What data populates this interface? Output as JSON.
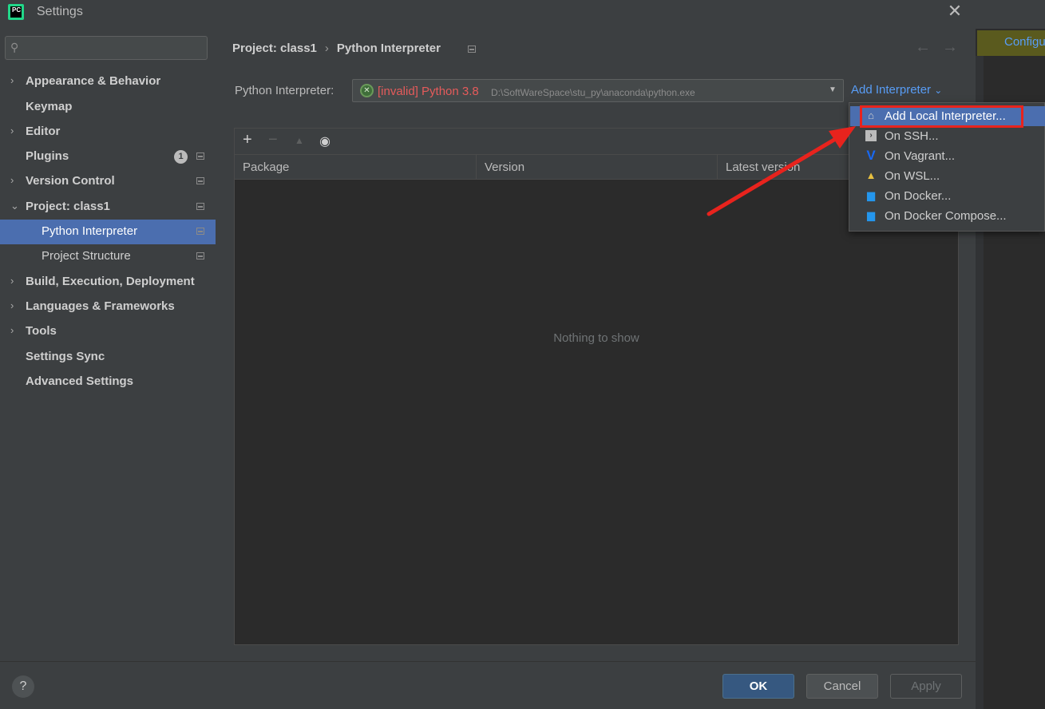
{
  "window": {
    "title": "Settings",
    "logo_text": "PC",
    "close_glyph": "✕"
  },
  "background_editor": {
    "banner_text": "Configure"
  },
  "search": {
    "placeholder": "",
    "icon": "search-icon"
  },
  "sidebar": {
    "items": [
      {
        "label": "Appearance & Behavior",
        "expandable": true,
        "expanded": false
      },
      {
        "label": "Keymap",
        "expandable": false
      },
      {
        "label": "Editor",
        "expandable": true,
        "expanded": false
      },
      {
        "label": "Plugins",
        "expandable": false,
        "badge": "1"
      },
      {
        "label": "Version Control",
        "expandable": true,
        "expanded": false
      },
      {
        "label": "Project: class1",
        "expandable": true,
        "expanded": true
      },
      {
        "label": "Python Interpreter",
        "sub": true,
        "selected": true
      },
      {
        "label": "Project Structure",
        "sub": true
      },
      {
        "label": "Build, Execution, Deployment",
        "expandable": true,
        "expanded": false
      },
      {
        "label": "Languages & Frameworks",
        "expandable": true,
        "expanded": false
      },
      {
        "label": "Tools",
        "expandable": true,
        "expanded": false
      },
      {
        "label": "Settings Sync",
        "expandable": false
      },
      {
        "label": "Advanced Settings",
        "expandable": false
      }
    ]
  },
  "breadcrumb": {
    "parent": "Project: class1",
    "separator": "›",
    "current": "Python Interpreter"
  },
  "nav": {
    "back": "←",
    "forward": "→"
  },
  "interpreter": {
    "label": "Python Interpreter:",
    "status": "[invalid] Python 3.8",
    "path": "D:\\SoftWareSpace\\stu_py\\anaconda\\python.exe",
    "add_label": "Add Interpreter",
    "add_chevron": "⌄"
  },
  "packages": {
    "toolbar": {
      "add": "+",
      "remove": "−",
      "up": "▲",
      "show": "👁"
    },
    "columns": [
      "Package",
      "Version",
      "Latest version"
    ],
    "empty_text": "Nothing to show"
  },
  "menu": {
    "items": [
      {
        "label": "Add Local Interpreter...",
        "icon": "home-icon",
        "active": true
      },
      {
        "label": "On SSH...",
        "icon": "terminal-icon"
      },
      {
        "label": "On Vagrant...",
        "icon": "vagrant-icon"
      },
      {
        "label": "On WSL...",
        "icon": "linux-icon"
      },
      {
        "label": "On Docker...",
        "icon": "docker-icon"
      },
      {
        "label": "On Docker Compose...",
        "icon": "docker-icon"
      }
    ]
  },
  "footer": {
    "help": "?",
    "ok": "OK",
    "cancel": "Cancel",
    "apply": "Apply"
  },
  "colors": {
    "accent": "#4b6eaf",
    "link": "#589df6",
    "error": "#e55b5b",
    "annotation": "#e8231d"
  }
}
